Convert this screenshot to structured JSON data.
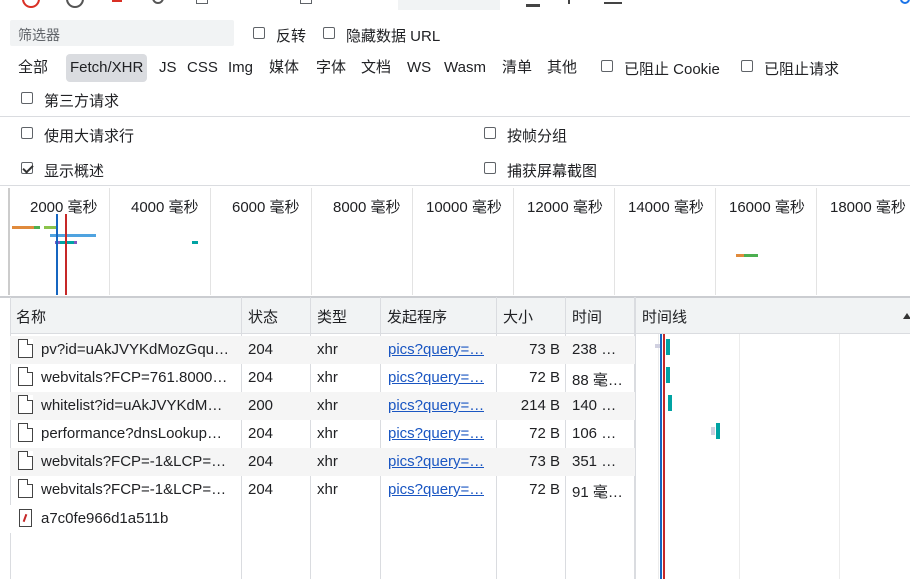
{
  "filter": {
    "placeholder": "筛选器",
    "invert_label": "反转",
    "hide_data_url_label": "隐藏数据 URL"
  },
  "filter_types": [
    "全部",
    "Fetch/XHR",
    "JS",
    "CSS",
    "Img",
    "媒体",
    "字体",
    "文档",
    "WS",
    "Wasm",
    "清单",
    "其他"
  ],
  "active_filter": "Fetch/XHR",
  "blocked_cookies_label": "已阻止 Cookie",
  "blocked_requests_label": "已阻止请求",
  "third_party_label": "第三方请求",
  "options": {
    "big_rows_label": "使用大请求行",
    "group_by_frame_label": "按帧分组",
    "show_overview_label": "显示概述",
    "capture_screenshots_label": "捕获屏幕截图"
  },
  "overview_ticks": [
    "2000 毫秒",
    "4000 毫秒",
    "6000 毫秒",
    "8000 毫秒",
    "10000 毫秒",
    "12000 毫秒",
    "14000 毫秒",
    "16000 毫秒",
    "18000 毫秒"
  ],
  "table": {
    "headers": {
      "name": "名称",
      "status": "状态",
      "type": "类型",
      "initiator": "发起程序",
      "size": "大小",
      "time": "时间",
      "waterfall": "时间线"
    },
    "rows": [
      {
        "name": "pv?id=uAkJVYKdMozGqu…",
        "status": "204",
        "type": "xhr",
        "initiator": "pics?query=…",
        "size": "73 B",
        "time": "238 …"
      },
      {
        "name": "webvitals?FCP=761.8000…",
        "status": "204",
        "type": "xhr",
        "initiator": "pics?query=…",
        "size": "72 B",
        "time": "88 毫…"
      },
      {
        "name": "whitelist?id=uAkJVYKdM…",
        "status": "200",
        "type": "xhr",
        "initiator": "pics?query=…",
        "size": "214 B",
        "time": "140 …"
      },
      {
        "name": "performance?dnsLookup…",
        "status": "204",
        "type": "xhr",
        "initiator": "pics?query=…",
        "size": "72 B",
        "time": "106 …"
      },
      {
        "name": "webvitals?FCP=-1&LCP=…",
        "status": "204",
        "type": "xhr",
        "initiator": "pics?query=…",
        "size": "73 B",
        "time": "351 …"
      },
      {
        "name": "webvitals?FCP=-1&LCP=…",
        "status": "204",
        "type": "xhr",
        "initiator": "pics?query=…",
        "size": "72 B",
        "time": "91 毫…"
      }
    ],
    "extra_row": {
      "name": "a7c0fe966d1a511b"
    }
  },
  "colors": {
    "accent": "#1a73e8",
    "waterfall_bar": "#00a3a3",
    "load_line": "#c62828",
    "dom_line": "#1565c0"
  }
}
